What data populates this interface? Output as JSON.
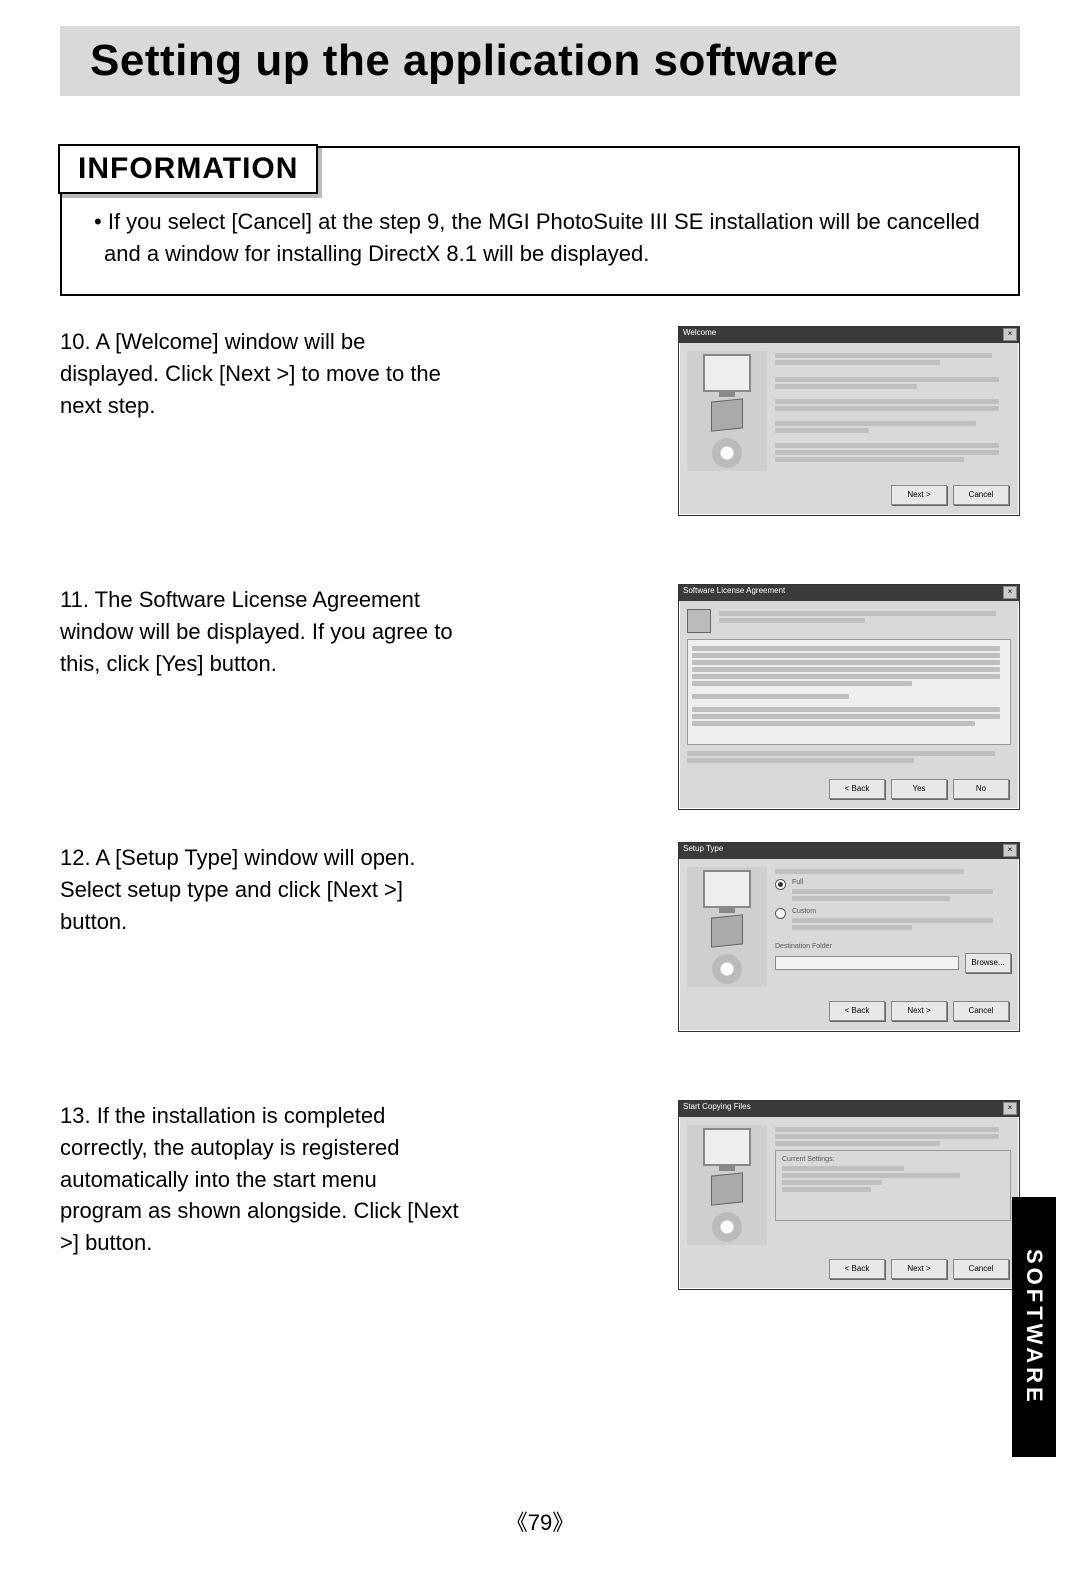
{
  "page": {
    "title": "Setting up the application software",
    "number": "79",
    "side_tab": "SOFTWARE"
  },
  "info": {
    "heading": "INFORMATION",
    "bullet": "If you select [Cancel] at the step 9, the MGI PhotoSuite III SE installation will be cancelled and a window for installing DirectX 8.1 will be displayed."
  },
  "steps": [
    {
      "num": "10.",
      "text": "A [Welcome] window will be displayed. Click [Next >] to move to the next step.",
      "dialog": {
        "title": "Welcome",
        "buttons": [
          "Next >",
          "Cancel"
        ]
      }
    },
    {
      "num": "11.",
      "text": "The Software License Agreement window will be displayed. If you agree to this, click [Yes] button.",
      "dialog": {
        "title": "Software License Agreement",
        "buttons": [
          "< Back",
          "Yes",
          "No"
        ]
      }
    },
    {
      "num": "12.",
      "text": "A [Setup Type] window will open. Select setup type and click [Next >] button.",
      "dialog": {
        "title": "Setup Type",
        "opt_full": "Full",
        "opt_custom": "Custom",
        "dest_label": "Destination Folder",
        "browse": "Browse...",
        "buttons": [
          "< Back",
          "Next >",
          "Cancel"
        ]
      }
    },
    {
      "num": "13.",
      "text": "If the installation is completed correctly, the autoplay is registered automatically into the start menu program as shown alongside. Click [Next >] button.",
      "dialog": {
        "title": "Start Copying Files",
        "group_label": "Current Settings:",
        "buttons": [
          "< Back",
          "Next >",
          "Cancel"
        ]
      }
    }
  ]
}
